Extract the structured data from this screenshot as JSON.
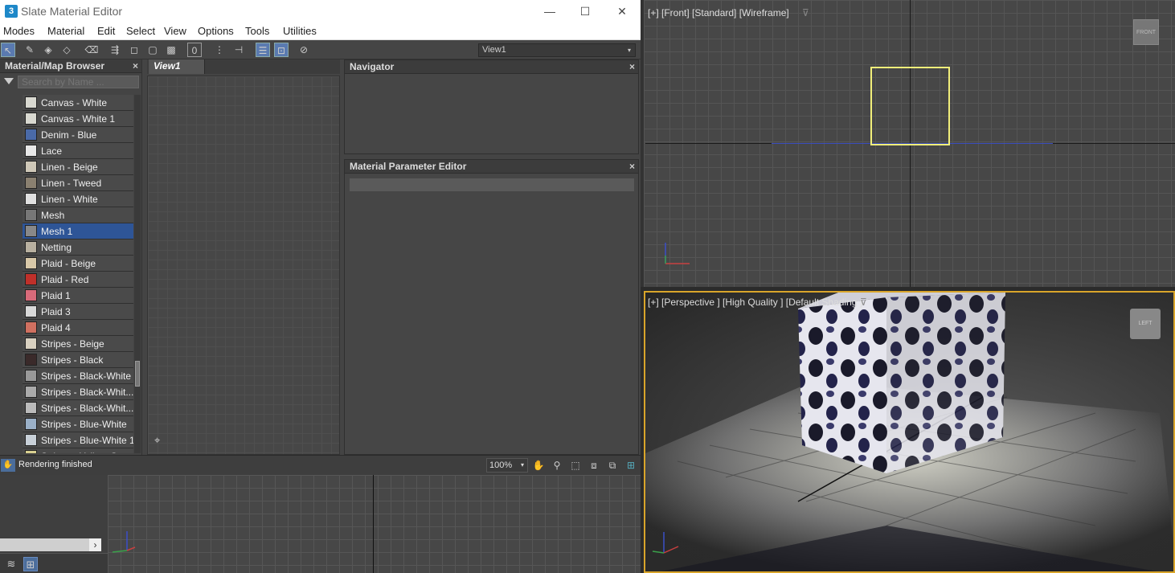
{
  "window": {
    "app_icon": "3",
    "title": "Slate Material Editor",
    "minimize": "—",
    "maximize": "☐",
    "close": "✕"
  },
  "menu": [
    "Modes",
    "Material",
    "Edit",
    "Select",
    "View",
    "Options",
    "Tools",
    "Utilities"
  ],
  "toolbar": {
    "view_select": "View1",
    "boxed_label": "0"
  },
  "browser": {
    "title": "Material/Map Browser",
    "search_placeholder": "Search by Name ...",
    "items": [
      {
        "label": "Canvas - White",
        "color": "#d8d8d0"
      },
      {
        "label": "Canvas - White 1",
        "color": "#d8d8d0"
      },
      {
        "label": "Denim - Blue",
        "color": "#4a6aa8"
      },
      {
        "label": "Lace",
        "color": "#e8e8e8"
      },
      {
        "label": "Linen - Beige",
        "color": "#cfc8b8"
      },
      {
        "label": "Linen - Tweed",
        "color": "#8a8070"
      },
      {
        "label": "Linen - White",
        "color": "#e0e0e0"
      },
      {
        "label": "Mesh",
        "color": "#777777"
      },
      {
        "label": "Mesh 1",
        "color": "#888888",
        "selected": true
      },
      {
        "label": "Netting",
        "color": "#b8b0a0"
      },
      {
        "label": "Plaid - Beige",
        "color": "#d8c8a8"
      },
      {
        "label": "Plaid - Red",
        "color": "#c0302a"
      },
      {
        "label": "Plaid 1",
        "color": "#d86a7a"
      },
      {
        "label": "Plaid 3",
        "color": "#d8d8d8"
      },
      {
        "label": "Plaid 4",
        "color": "#d07060"
      },
      {
        "label": "Stripes - Beige",
        "color": "#d8d0c0"
      },
      {
        "label": "Stripes - Black",
        "color": "#3a2a2a"
      },
      {
        "label": "Stripes - Black-White",
        "color": "#999999"
      },
      {
        "label": "Stripes - Black-Whit...",
        "color": "#aaaaaa"
      },
      {
        "label": "Stripes - Black-Whit...",
        "color": "#bbbbbb"
      },
      {
        "label": "Stripes - Blue-White",
        "color": "#9ab0c8"
      },
      {
        "label": "Stripes - Blue-White 1",
        "color": "#c8d0d8"
      },
      {
        "label": "Stripes - Yellow-G...",
        "color": "#d8d090"
      }
    ]
  },
  "view": {
    "tab": "View1"
  },
  "navigator": {
    "title": "Navigator"
  },
  "param_editor": {
    "title": "Material Parameter Editor"
  },
  "status": {
    "text": "Rendering finished",
    "zoom": "100%"
  },
  "viewports": {
    "front": {
      "label": "[+] [Front] [Standard] [Wireframe]",
      "viewcube": "FRONT"
    },
    "perspective": {
      "label": "[+] [Perspective ] [High Quality ] [Default Shading ]",
      "viewcube": "LEFT"
    }
  },
  "icons": {
    "panel_close": "×",
    "dropdown_arrow": "▾",
    "slider_arrow": "›",
    "binoculars": "⌖",
    "funnel": "⊽",
    "select": "↖",
    "eyedropper": "✎",
    "trash": "🗑",
    "hand": "✋",
    "zoom": "⚲",
    "layers": "≋",
    "scene": "⊞"
  }
}
